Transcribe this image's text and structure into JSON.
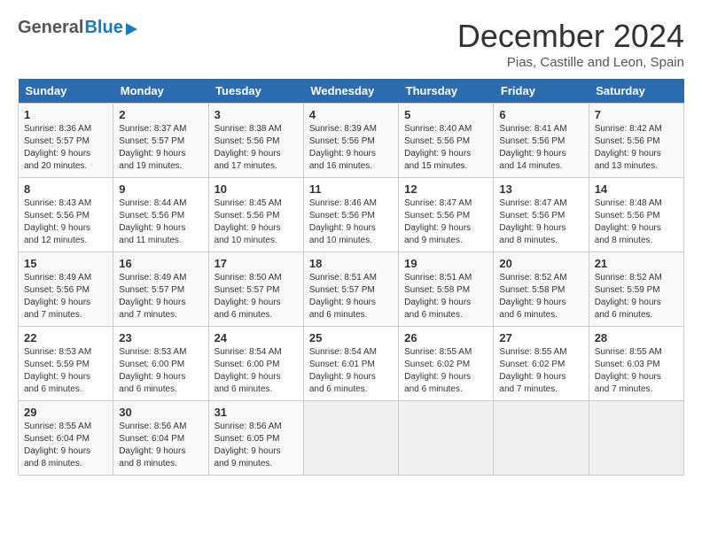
{
  "header": {
    "logo_general": "General",
    "logo_blue": "Blue",
    "month_title": "December 2024",
    "subtitle": "Pias, Castille and Leon, Spain"
  },
  "days_of_week": [
    "Sunday",
    "Monday",
    "Tuesday",
    "Wednesday",
    "Thursday",
    "Friday",
    "Saturday"
  ],
  "weeks": [
    [
      {
        "day": "1",
        "sunrise": "Sunrise: 8:36 AM",
        "sunset": "Sunset: 5:57 PM",
        "daylight": "Daylight: 9 hours and 20 minutes."
      },
      {
        "day": "2",
        "sunrise": "Sunrise: 8:37 AM",
        "sunset": "Sunset: 5:57 PM",
        "daylight": "Daylight: 9 hours and 19 minutes."
      },
      {
        "day": "3",
        "sunrise": "Sunrise: 8:38 AM",
        "sunset": "Sunset: 5:56 PM",
        "daylight": "Daylight: 9 hours and 17 minutes."
      },
      {
        "day": "4",
        "sunrise": "Sunrise: 8:39 AM",
        "sunset": "Sunset: 5:56 PM",
        "daylight": "Daylight: 9 hours and 16 minutes."
      },
      {
        "day": "5",
        "sunrise": "Sunrise: 8:40 AM",
        "sunset": "Sunset: 5:56 PM",
        "daylight": "Daylight: 9 hours and 15 minutes."
      },
      {
        "day": "6",
        "sunrise": "Sunrise: 8:41 AM",
        "sunset": "Sunset: 5:56 PM",
        "daylight": "Daylight: 9 hours and 14 minutes."
      },
      {
        "day": "7",
        "sunrise": "Sunrise: 8:42 AM",
        "sunset": "Sunset: 5:56 PM",
        "daylight": "Daylight: 9 hours and 13 minutes."
      }
    ],
    [
      {
        "day": "8",
        "sunrise": "Sunrise: 8:43 AM",
        "sunset": "Sunset: 5:56 PM",
        "daylight": "Daylight: 9 hours and 12 minutes."
      },
      {
        "day": "9",
        "sunrise": "Sunrise: 8:44 AM",
        "sunset": "Sunset: 5:56 PM",
        "daylight": "Daylight: 9 hours and 11 minutes."
      },
      {
        "day": "10",
        "sunrise": "Sunrise: 8:45 AM",
        "sunset": "Sunset: 5:56 PM",
        "daylight": "Daylight: 9 hours and 10 minutes."
      },
      {
        "day": "11",
        "sunrise": "Sunrise: 8:46 AM",
        "sunset": "Sunset: 5:56 PM",
        "daylight": "Daylight: 9 hours and 10 minutes."
      },
      {
        "day": "12",
        "sunrise": "Sunrise: 8:47 AM",
        "sunset": "Sunset: 5:56 PM",
        "daylight": "Daylight: 9 hours and 9 minutes."
      },
      {
        "day": "13",
        "sunrise": "Sunrise: 8:47 AM",
        "sunset": "Sunset: 5:56 PM",
        "daylight": "Daylight: 9 hours and 8 minutes."
      },
      {
        "day": "14",
        "sunrise": "Sunrise: 8:48 AM",
        "sunset": "Sunset: 5:56 PM",
        "daylight": "Daylight: 9 hours and 8 minutes."
      }
    ],
    [
      {
        "day": "15",
        "sunrise": "Sunrise: 8:49 AM",
        "sunset": "Sunset: 5:56 PM",
        "daylight": "Daylight: 9 hours and 7 minutes."
      },
      {
        "day": "16",
        "sunrise": "Sunrise: 8:49 AM",
        "sunset": "Sunset: 5:57 PM",
        "daylight": "Daylight: 9 hours and 7 minutes."
      },
      {
        "day": "17",
        "sunrise": "Sunrise: 8:50 AM",
        "sunset": "Sunset: 5:57 PM",
        "daylight": "Daylight: 9 hours and 6 minutes."
      },
      {
        "day": "18",
        "sunrise": "Sunrise: 8:51 AM",
        "sunset": "Sunset: 5:57 PM",
        "daylight": "Daylight: 9 hours and 6 minutes."
      },
      {
        "day": "19",
        "sunrise": "Sunrise: 8:51 AM",
        "sunset": "Sunset: 5:58 PM",
        "daylight": "Daylight: 9 hours and 6 minutes."
      },
      {
        "day": "20",
        "sunrise": "Sunrise: 8:52 AM",
        "sunset": "Sunset: 5:58 PM",
        "daylight": "Daylight: 9 hours and 6 minutes."
      },
      {
        "day": "21",
        "sunrise": "Sunrise: 8:52 AM",
        "sunset": "Sunset: 5:59 PM",
        "daylight": "Daylight: 9 hours and 6 minutes."
      }
    ],
    [
      {
        "day": "22",
        "sunrise": "Sunrise: 8:53 AM",
        "sunset": "Sunset: 5:59 PM",
        "daylight": "Daylight: 9 hours and 6 minutes."
      },
      {
        "day": "23",
        "sunrise": "Sunrise: 8:53 AM",
        "sunset": "Sunset: 6:00 PM",
        "daylight": "Daylight: 9 hours and 6 minutes."
      },
      {
        "day": "24",
        "sunrise": "Sunrise: 8:54 AM",
        "sunset": "Sunset: 6:00 PM",
        "daylight": "Daylight: 9 hours and 6 minutes."
      },
      {
        "day": "25",
        "sunrise": "Sunrise: 8:54 AM",
        "sunset": "Sunset: 6:01 PM",
        "daylight": "Daylight: 9 hours and 6 minutes."
      },
      {
        "day": "26",
        "sunrise": "Sunrise: 8:55 AM",
        "sunset": "Sunset: 6:02 PM",
        "daylight": "Daylight: 9 hours and 6 minutes."
      },
      {
        "day": "27",
        "sunrise": "Sunrise: 8:55 AM",
        "sunset": "Sunset: 6:02 PM",
        "daylight": "Daylight: 9 hours and 7 minutes."
      },
      {
        "day": "28",
        "sunrise": "Sunrise: 8:55 AM",
        "sunset": "Sunset: 6:03 PM",
        "daylight": "Daylight: 9 hours and 7 minutes."
      }
    ],
    [
      {
        "day": "29",
        "sunrise": "Sunrise: 8:55 AM",
        "sunset": "Sunset: 6:04 PM",
        "daylight": "Daylight: 9 hours and 8 minutes."
      },
      {
        "day": "30",
        "sunrise": "Sunrise: 8:56 AM",
        "sunset": "Sunset: 6:04 PM",
        "daylight": "Daylight: 9 hours and 8 minutes."
      },
      {
        "day": "31",
        "sunrise": "Sunrise: 8:56 AM",
        "sunset": "Sunset: 6:05 PM",
        "daylight": "Daylight: 9 hours and 9 minutes."
      },
      null,
      null,
      null,
      null
    ]
  ]
}
